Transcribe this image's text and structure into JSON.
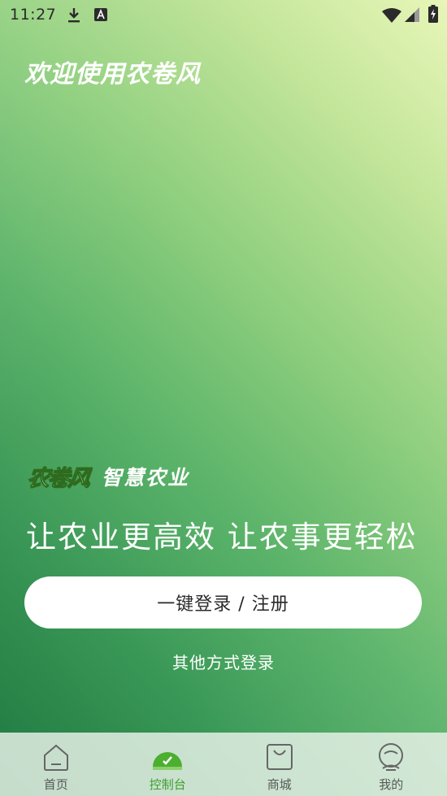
{
  "status_bar": {
    "time": "11:27",
    "icons": [
      "download-icon",
      "app-notification-icon",
      "wifi-icon",
      "signal-icon",
      "battery-charging-icon"
    ]
  },
  "welcome": {
    "title": "欢迎使用农卷风"
  },
  "brand": {
    "logo_text": "农卷风",
    "tagline": "智慧农业"
  },
  "slogan": "让农业更高效 让农事更轻松",
  "login": {
    "primary_button": "一键登录 / 注册",
    "other_methods": "其他方式登录"
  },
  "bottom_nav": {
    "items": [
      {
        "label": "首页",
        "icon": "home-icon",
        "active": false
      },
      {
        "label": "控制台",
        "icon": "dashboard-gauge-icon",
        "active": true
      },
      {
        "label": "商城",
        "icon": "shopping-bag-icon",
        "active": false
      },
      {
        "label": "我的",
        "icon": "profile-icon",
        "active": false
      }
    ]
  },
  "colors": {
    "accent": "#3f9f2e",
    "background_top": "#e8f6b8",
    "background_bottom": "#1f7f42"
  }
}
